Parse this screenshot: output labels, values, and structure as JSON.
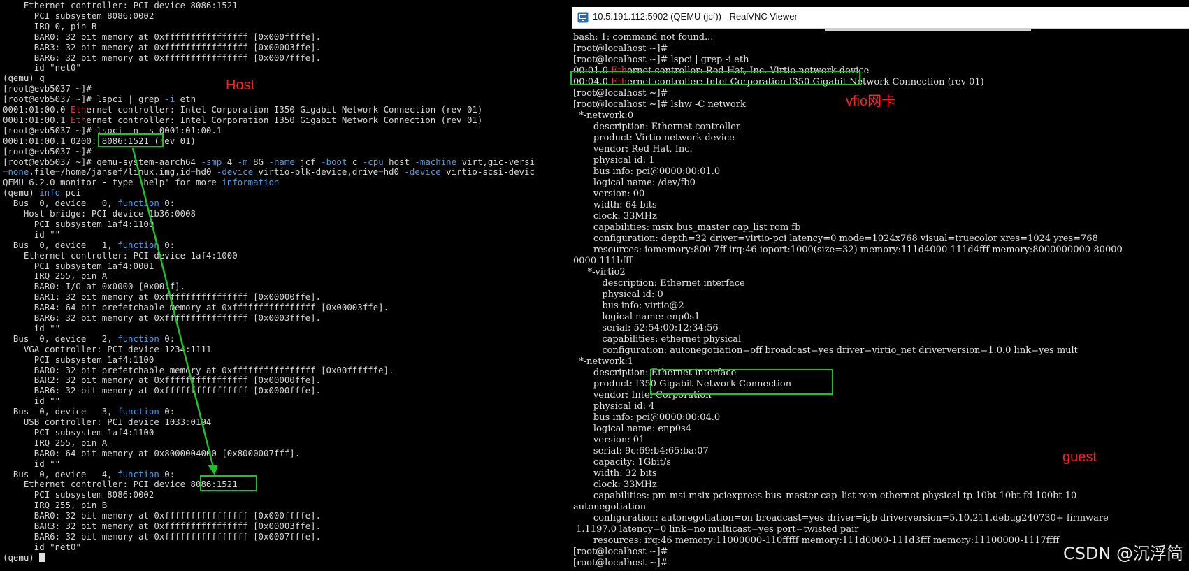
{
  "host_terminal": {
    "lines": [
      [
        {
          "t": "    Ethernet controller: PCI device 8086:1521"
        }
      ],
      [
        {
          "t": "      PCI subsystem 8086:0002"
        }
      ],
      [
        {
          "t": "      IRQ 0, pin B"
        }
      ],
      [
        {
          "t": "      BAR0: 32 bit memory at 0xffffffffffffffff [0x000ffffe]."
        }
      ],
      [
        {
          "t": "      BAR3: 32 bit memory at 0xffffffffffffffff [0x00003ffe]."
        }
      ],
      [
        {
          "t": "      BAR6: 32 bit memory at 0xffffffffffffffff [0x0007fffe]."
        }
      ],
      [
        {
          "t": "      id \"net0\""
        }
      ],
      [
        {
          "t": "(qemu) q"
        }
      ],
      [
        {
          "t": "[root@evb5037 ~]#"
        }
      ],
      [
        {
          "t": "[root@evb5037 ~]# lspci | grep "
        },
        {
          "t": "-i",
          "c": "blue"
        },
        {
          "t": " eth"
        }
      ],
      [
        {
          "t": "0001:01:00.0 "
        },
        {
          "t": "Eth",
          "c": "red"
        },
        {
          "t": "ernet controller: Intel Corporation I350 Gigabit Network Connection (rev 01)"
        }
      ],
      [
        {
          "t": "0001:01:00.1 "
        },
        {
          "t": "Eth",
          "c": "red"
        },
        {
          "t": "ernet controller: Intel Corporation I350 Gigabit Network Connection (rev 01)"
        }
      ],
      [
        {
          "t": "[root@evb5037 ~]# lspci -n -s 0001:01:00.1"
        }
      ],
      [
        {
          "t": "0001:01:00.1 0200: 8086:1521 (rev 01)"
        }
      ],
      [
        {
          "t": "[root@evb5037 ~]#"
        }
      ],
      [
        {
          "t": "[root@evb5037 ~]# qemu-system-aarch64 "
        },
        {
          "t": "-smp",
          "c": "blue"
        },
        {
          "t": " 4 "
        },
        {
          "t": "-m",
          "c": "blue"
        },
        {
          "t": " 8G "
        },
        {
          "t": "-name",
          "c": "blue"
        },
        {
          "t": " jcf "
        },
        {
          "t": "-boot",
          "c": "blue"
        },
        {
          "t": " c "
        },
        {
          "t": "-cpu",
          "c": "blue"
        },
        {
          "t": " host "
        },
        {
          "t": "-machine",
          "c": "blue"
        },
        {
          "t": " virt,gic-versi"
        }
      ],
      [
        {
          "t": "=none",
          "c": "blue"
        },
        {
          "t": ",file=/home/jansef/linux.img,id=hd0 "
        },
        {
          "t": "-device",
          "c": "blue"
        },
        {
          "t": " virtio-blk-device,drive=hd0 "
        },
        {
          "t": "-device",
          "c": "blue"
        },
        {
          "t": " virtio-scsi-devic"
        }
      ],
      [
        {
          "t": "QEMU 6.2.0 monitor - type 'help' for more "
        },
        {
          "t": "information",
          "c": "blue"
        }
      ],
      [
        {
          "t": "(qemu) "
        },
        {
          "t": "info",
          "c": "blue"
        },
        {
          "t": " pci"
        }
      ],
      [
        {
          "t": "  Bus  0, device   0, "
        },
        {
          "t": "function",
          "c": "blue"
        },
        {
          "t": " 0:"
        }
      ],
      [
        {
          "t": "    Host bridge: PCI device 1b36:0008"
        }
      ],
      [
        {
          "t": "      PCI subsystem 1af4:1100"
        }
      ],
      [
        {
          "t": "      id \"\""
        }
      ],
      [
        {
          "t": "  Bus  0, device   1, "
        },
        {
          "t": "function",
          "c": "blue"
        },
        {
          "t": " 0:"
        }
      ],
      [
        {
          "t": "    Ethernet controller: PCI device 1af4:1000"
        }
      ],
      [
        {
          "t": "      PCI subsystem 1af4:0001"
        }
      ],
      [
        {
          "t": "      IRQ 255, pin A"
        }
      ],
      [
        {
          "t": "      BAR0: I/O at 0x0000 [0x001f]."
        }
      ],
      [
        {
          "t": "      BAR1: 32 bit memory at 0xffffffffffffffff [0x00000ffe]."
        }
      ],
      [
        {
          "t": "      BAR4: 64 bit prefetchable memory at 0xffffffffffffffff [0x00003ffe]."
        }
      ],
      [
        {
          "t": "      BAR6: 32 bit memory at 0xffffffffffffffff [0x0003fffe]."
        }
      ],
      [
        {
          "t": "      id \"\""
        }
      ],
      [
        {
          "t": "  Bus  0, device   2, "
        },
        {
          "t": "function",
          "c": "blue"
        },
        {
          "t": " 0:"
        }
      ],
      [
        {
          "t": "    VGA controller: PCI device 1234:1111"
        }
      ],
      [
        {
          "t": "      PCI subsystem 1af4:1100"
        }
      ],
      [
        {
          "t": "      BAR0: 32 bit prefetchable memory at 0xffffffffffffffff [0x00ffffffe]."
        }
      ],
      [
        {
          "t": "      BAR2: 32 bit memory at 0xffffffffffffffff [0x00000ffe]."
        }
      ],
      [
        {
          "t": "      BAR6: 32 bit memory at 0xffffffffffffffff [0x0000fffe]."
        }
      ],
      [
        {
          "t": "      id \"\""
        }
      ],
      [
        {
          "t": "  Bus  0, device   3, "
        },
        {
          "t": "function",
          "c": "blue"
        },
        {
          "t": " 0:"
        }
      ],
      [
        {
          "t": "    USB controller: PCI device 1033:0194"
        }
      ],
      [
        {
          "t": "      PCI subsystem 1af4:1100"
        }
      ],
      [
        {
          "t": "      IRQ 255, pin A"
        }
      ],
      [
        {
          "t": "      BAR0: 64 bit memory at 0x8000004000 [0x8000007fff]."
        }
      ],
      [
        {
          "t": "      id \"\""
        }
      ],
      [
        {
          "t": "  Bus  0, device   4, "
        },
        {
          "t": "function",
          "c": "blue"
        },
        {
          "t": " 0:"
        }
      ],
      [
        {
          "t": "    Ethernet controller: PCI device 8086:1521"
        }
      ],
      [
        {
          "t": "      PCI subsystem 8086:0002"
        }
      ],
      [
        {
          "t": "      IRQ 255, pin B"
        }
      ],
      [
        {
          "t": "      BAR0: 32 bit memory at 0xffffffffffffffff [0x000ffffe]."
        }
      ],
      [
        {
          "t": "      BAR3: 32 bit memory at 0xffffffffffffffff [0x00003ffe]."
        }
      ],
      [
        {
          "t": "      BAR6: 32 bit memory at 0xffffffffffffffff [0x0007fffe]."
        }
      ],
      [
        {
          "t": "      id \"net0\""
        }
      ],
      [
        {
          "t": "(qemu) "
        }
      ]
    ]
  },
  "vnc": {
    "title": "10.5.191.112:5902 (QEMU (jcf)) - RealVNC Viewer",
    "icon": "realvnc-icon",
    "lines": [
      [
        {
          "t": "bash: 1: command not found..."
        }
      ],
      [
        {
          "t": "[root@localhost ~]#"
        }
      ],
      [
        {
          "t": "[root@localhost ~]# lspci | grep -i eth"
        }
      ],
      [
        {
          "t": "00:01.0 "
        },
        {
          "t": "Eth",
          "c": "red"
        },
        {
          "t": "ernet controller: Red Hat, Inc. Virtio network device"
        }
      ],
      [
        {
          "t": "00:04.0 "
        },
        {
          "t": "Eth",
          "c": "red"
        },
        {
          "t": "ernet controller: Intel Corporation I350 Gigabit Network Connection (rev 01)"
        }
      ],
      [
        {
          "t": "[root@localhost ~]#"
        }
      ],
      [
        {
          "t": "[root@localhost ~]# lshw -C network"
        }
      ],
      [
        {
          "t": "  *-network:0"
        }
      ],
      [
        {
          "t": "       description: Ethernet controller"
        }
      ],
      [
        {
          "t": "       product: Virtio network device"
        }
      ],
      [
        {
          "t": "       vendor: Red Hat, Inc."
        }
      ],
      [
        {
          "t": "       physical id: 1"
        }
      ],
      [
        {
          "t": "       bus info: pci@0000:00:01.0"
        }
      ],
      [
        {
          "t": "       logical name: /dev/fb0"
        }
      ],
      [
        {
          "t": "       version: 00"
        }
      ],
      [
        {
          "t": "       width: 64 bits"
        }
      ],
      [
        {
          "t": "       clock: 33MHz"
        }
      ],
      [
        {
          "t": "       capabilities: msix bus_master cap_list rom fb"
        }
      ],
      [
        {
          "t": "       configuration: depth=32 driver=virtio-pci latency=0 mode=1024x768 visual=truecolor xres=1024 yres=768"
        }
      ],
      [
        {
          "t": "       resources: iomemory:800-7ff irq:46 ioport:1000(size=32) memory:111d4000-111d4fff memory:8000000000-80000"
        }
      ],
      [
        {
          "t": "0000-111bfff"
        }
      ],
      [
        {
          "t": "     *-virtio2"
        }
      ],
      [
        {
          "t": "          description: Ethernet interface"
        }
      ],
      [
        {
          "t": "          physical id: 0"
        }
      ],
      [
        {
          "t": "          bus info: virtio@2"
        }
      ],
      [
        {
          "t": "          logical name: enp0s1"
        }
      ],
      [
        {
          "t": "          serial: 52:54:00:12:34:56"
        }
      ],
      [
        {
          "t": "          capabilities: ethernet physical"
        }
      ],
      [
        {
          "t": "          configuration: autonegotiation=off broadcast=yes driver=virtio_net driverversion=1.0.0 link=yes mult"
        }
      ],
      [
        {
          "t": "  *-network:1"
        }
      ],
      [
        {
          "t": "       description: Ethernet interface"
        }
      ],
      [
        {
          "t": "       product: I350 Gigabit Network Connection"
        }
      ],
      [
        {
          "t": "       vendor: Intel Corporation"
        }
      ],
      [
        {
          "t": "       physical id: 4"
        }
      ],
      [
        {
          "t": "       bus info: pci@0000:00:04.0"
        }
      ],
      [
        {
          "t": "       logical name: enp0s4"
        }
      ],
      [
        {
          "t": "       version: 01"
        }
      ],
      [
        {
          "t": "       serial: 9c:69:b4:65:ba:07"
        }
      ],
      [
        {
          "t": "       capacity: 1Gbit/s"
        }
      ],
      [
        {
          "t": "       width: 32 bits"
        }
      ],
      [
        {
          "t": "       clock: 33MHz"
        }
      ],
      [
        {
          "t": "       capabilities: pm msi msix pciexpress bus_master cap_list rom ethernet physical tp 10bt 10bt-fd 100bt 10"
        }
      ],
      [
        {
          "t": "autonegotiation"
        }
      ],
      [
        {
          "t": "       configuration: autonegotiation=on broadcast=yes driver=igb driverversion=5.10.211.debug240730+ firmware"
        }
      ],
      [
        {
          "t": " 1.1197.0 latency=0 link=no multicast=yes port=twisted pair"
        }
      ],
      [
        {
          "t": "       resources: irq:46 memory:11000000-110fffff memory:111d0000-111d3fff memory:11100000-1117ffff"
        }
      ],
      [
        {
          "t": "[root@localhost ~]#"
        }
      ],
      [
        {
          "t": "[root@localhost ~]#"
        }
      ]
    ]
  },
  "annotations": {
    "host": "Host",
    "vfio": "vfio网卡",
    "guest": "guest",
    "watermark": "CSDN @沉浮简"
  },
  "colors": {
    "highlight_box": "#1fc02a",
    "annotation_text": "#ff2020",
    "terminal_text": "#d8d8d8",
    "keyword_blue": "#4f9be8",
    "grep_match_red": "#d83a3a"
  }
}
